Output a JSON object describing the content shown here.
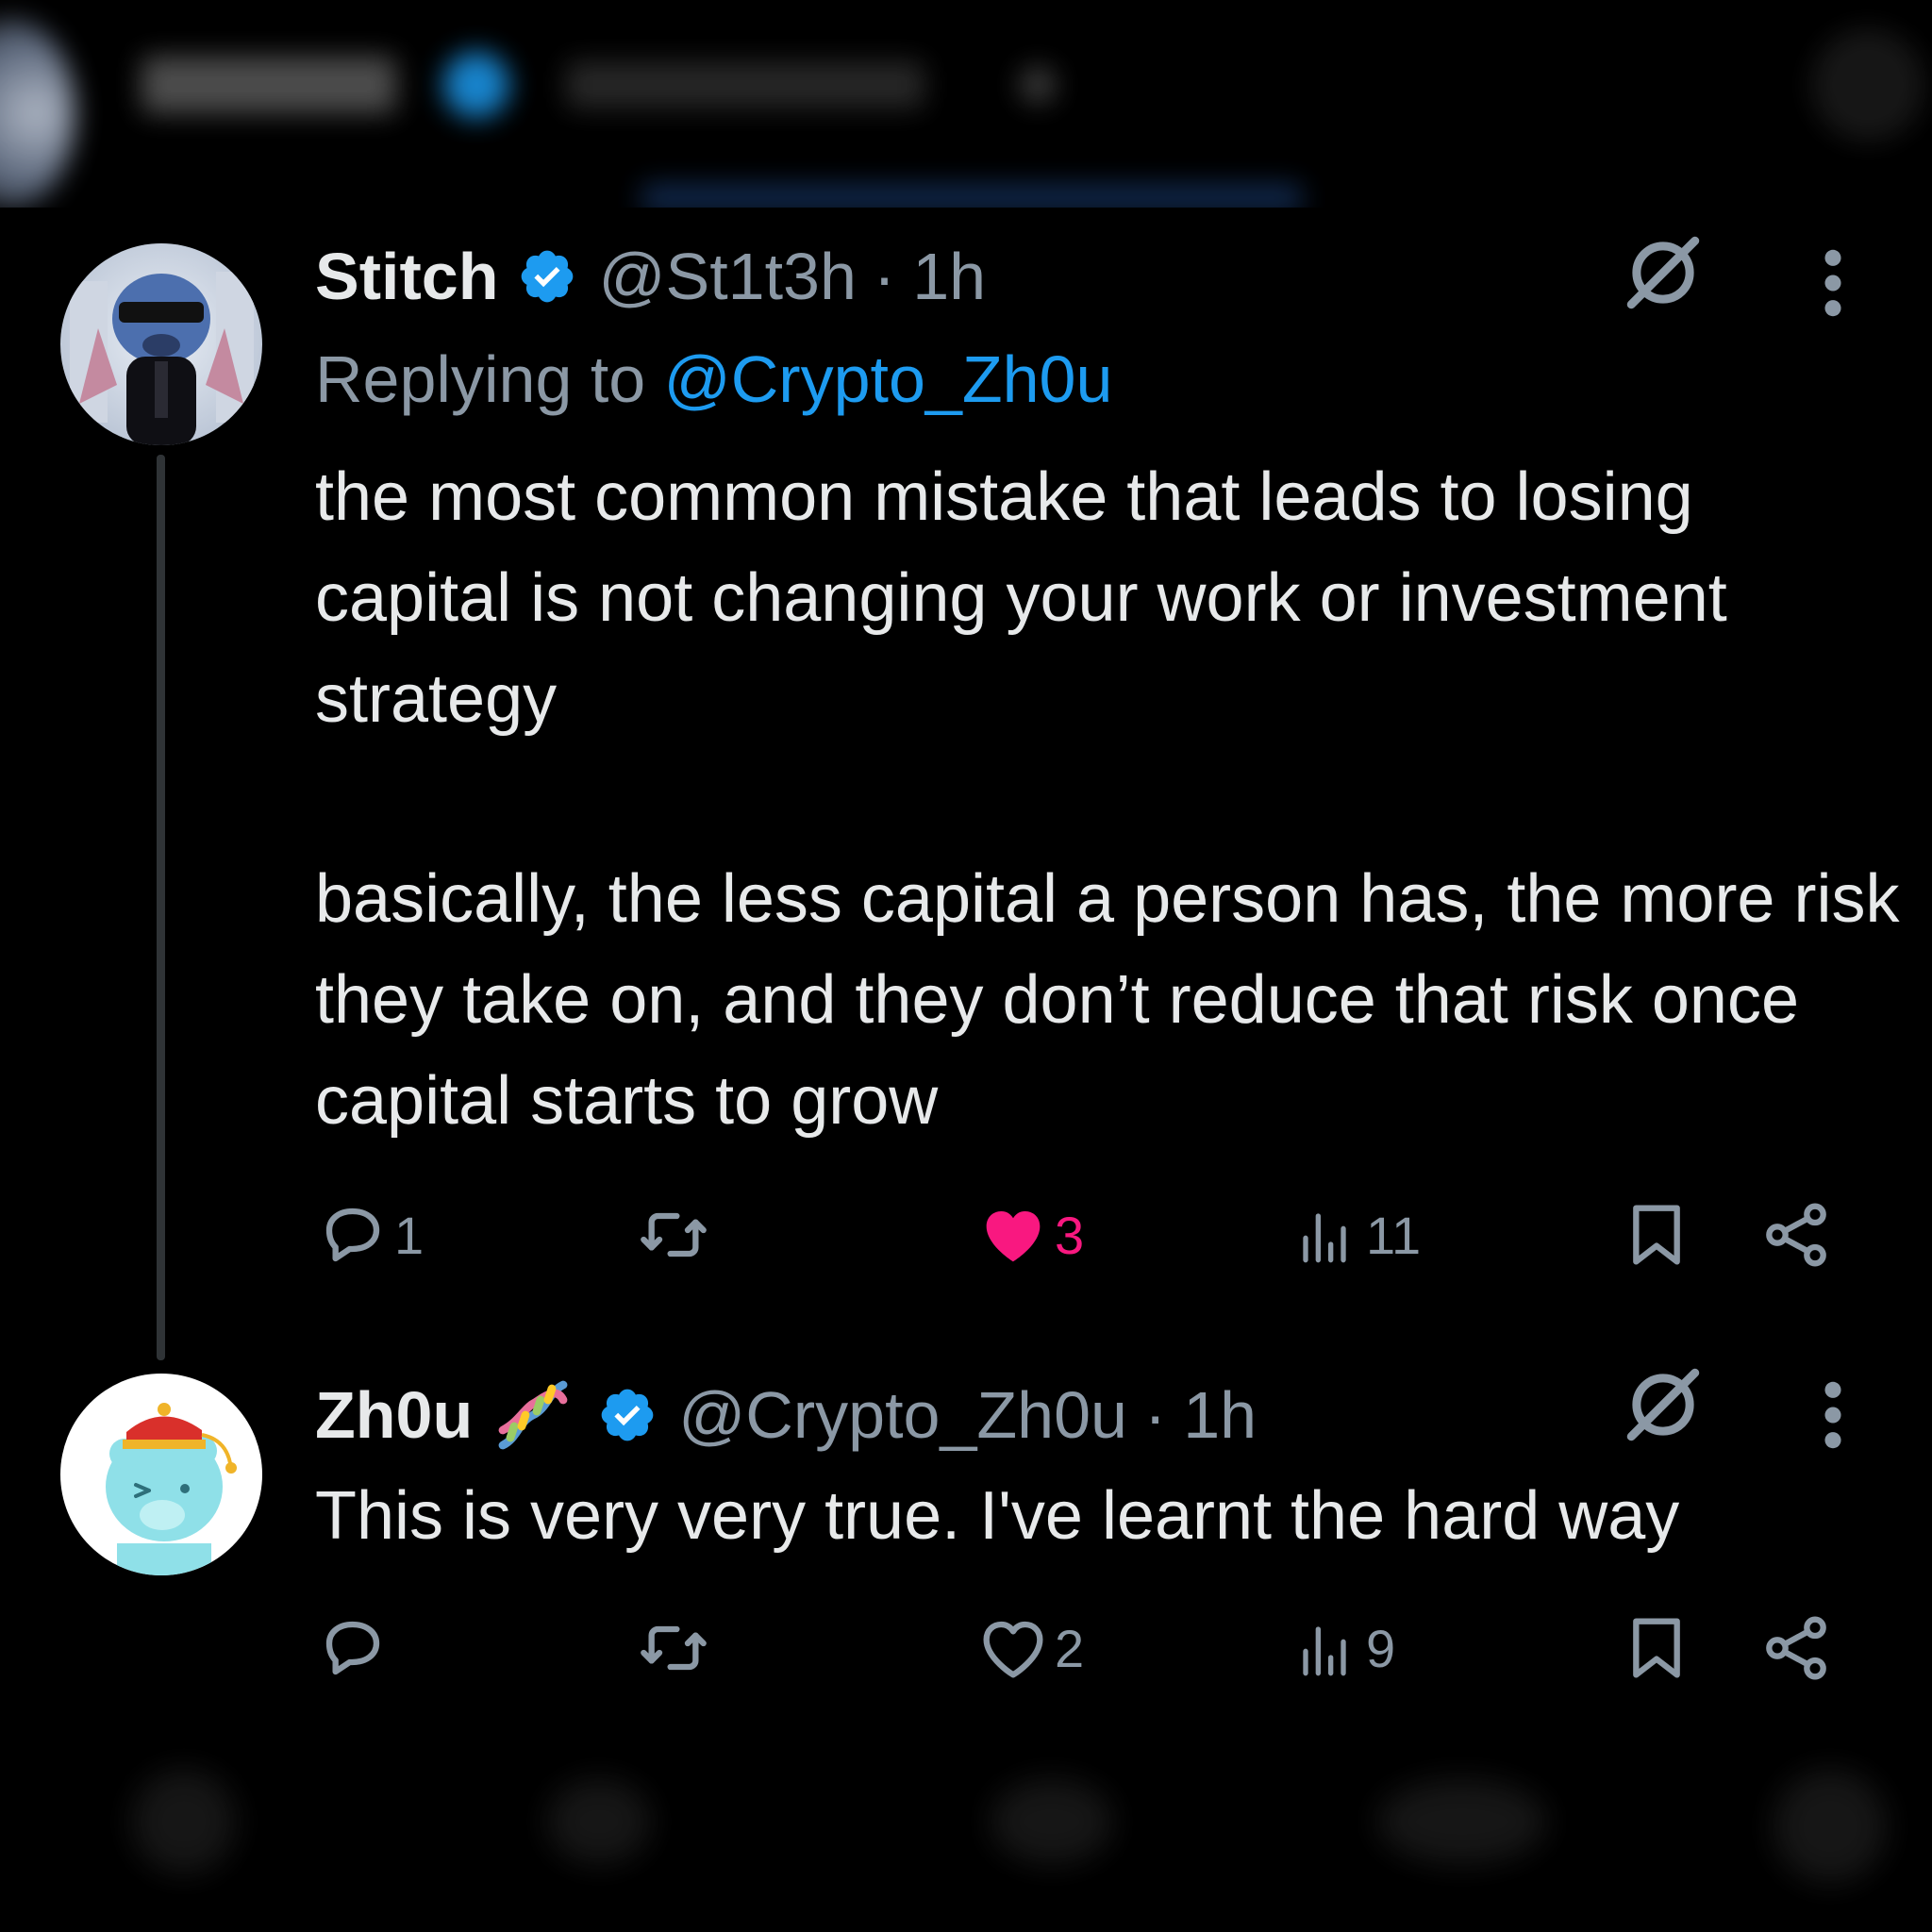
{
  "tweets": [
    {
      "name": "Stitch",
      "handle": "@St1t3h",
      "separator": "·",
      "time": "1h",
      "replying_prefix": "Replying to",
      "replying_handle": "@Crypto_Zh0u",
      "text_p1": "the most common mistake that leads to losing capital is not changing your work or investment strategy",
      "text_p2": "basically, the less capital a person has, the more risk they take on, and they don’t reduce that risk once capital starts to grow",
      "actions": {
        "replies": "1",
        "retweets": "",
        "likes": "3",
        "views": "11",
        "liked": true
      }
    },
    {
      "name": "Zh0u",
      "handle": "@Crypto_Zh0u",
      "separator": "·",
      "time": "1h",
      "text_p1": "This is very very true. I've learnt the hard way",
      "actions": {
        "replies": "",
        "retweets": "",
        "likes": "2",
        "views": "9",
        "liked": false
      }
    }
  ],
  "colors": {
    "background": "#000000",
    "text": "#e7e9ea",
    "muted": "#8b98a5",
    "accent": "#1d9bf0",
    "like": "#f91880",
    "thread": "#2f3336"
  },
  "icons": [
    "verified-badge-icon",
    "dna-emoji-icon",
    "grok-icon",
    "more-vertical-icon",
    "reply-icon",
    "retweet-icon",
    "heart-icon",
    "views-icon",
    "bookmark-icon",
    "share-icon"
  ]
}
